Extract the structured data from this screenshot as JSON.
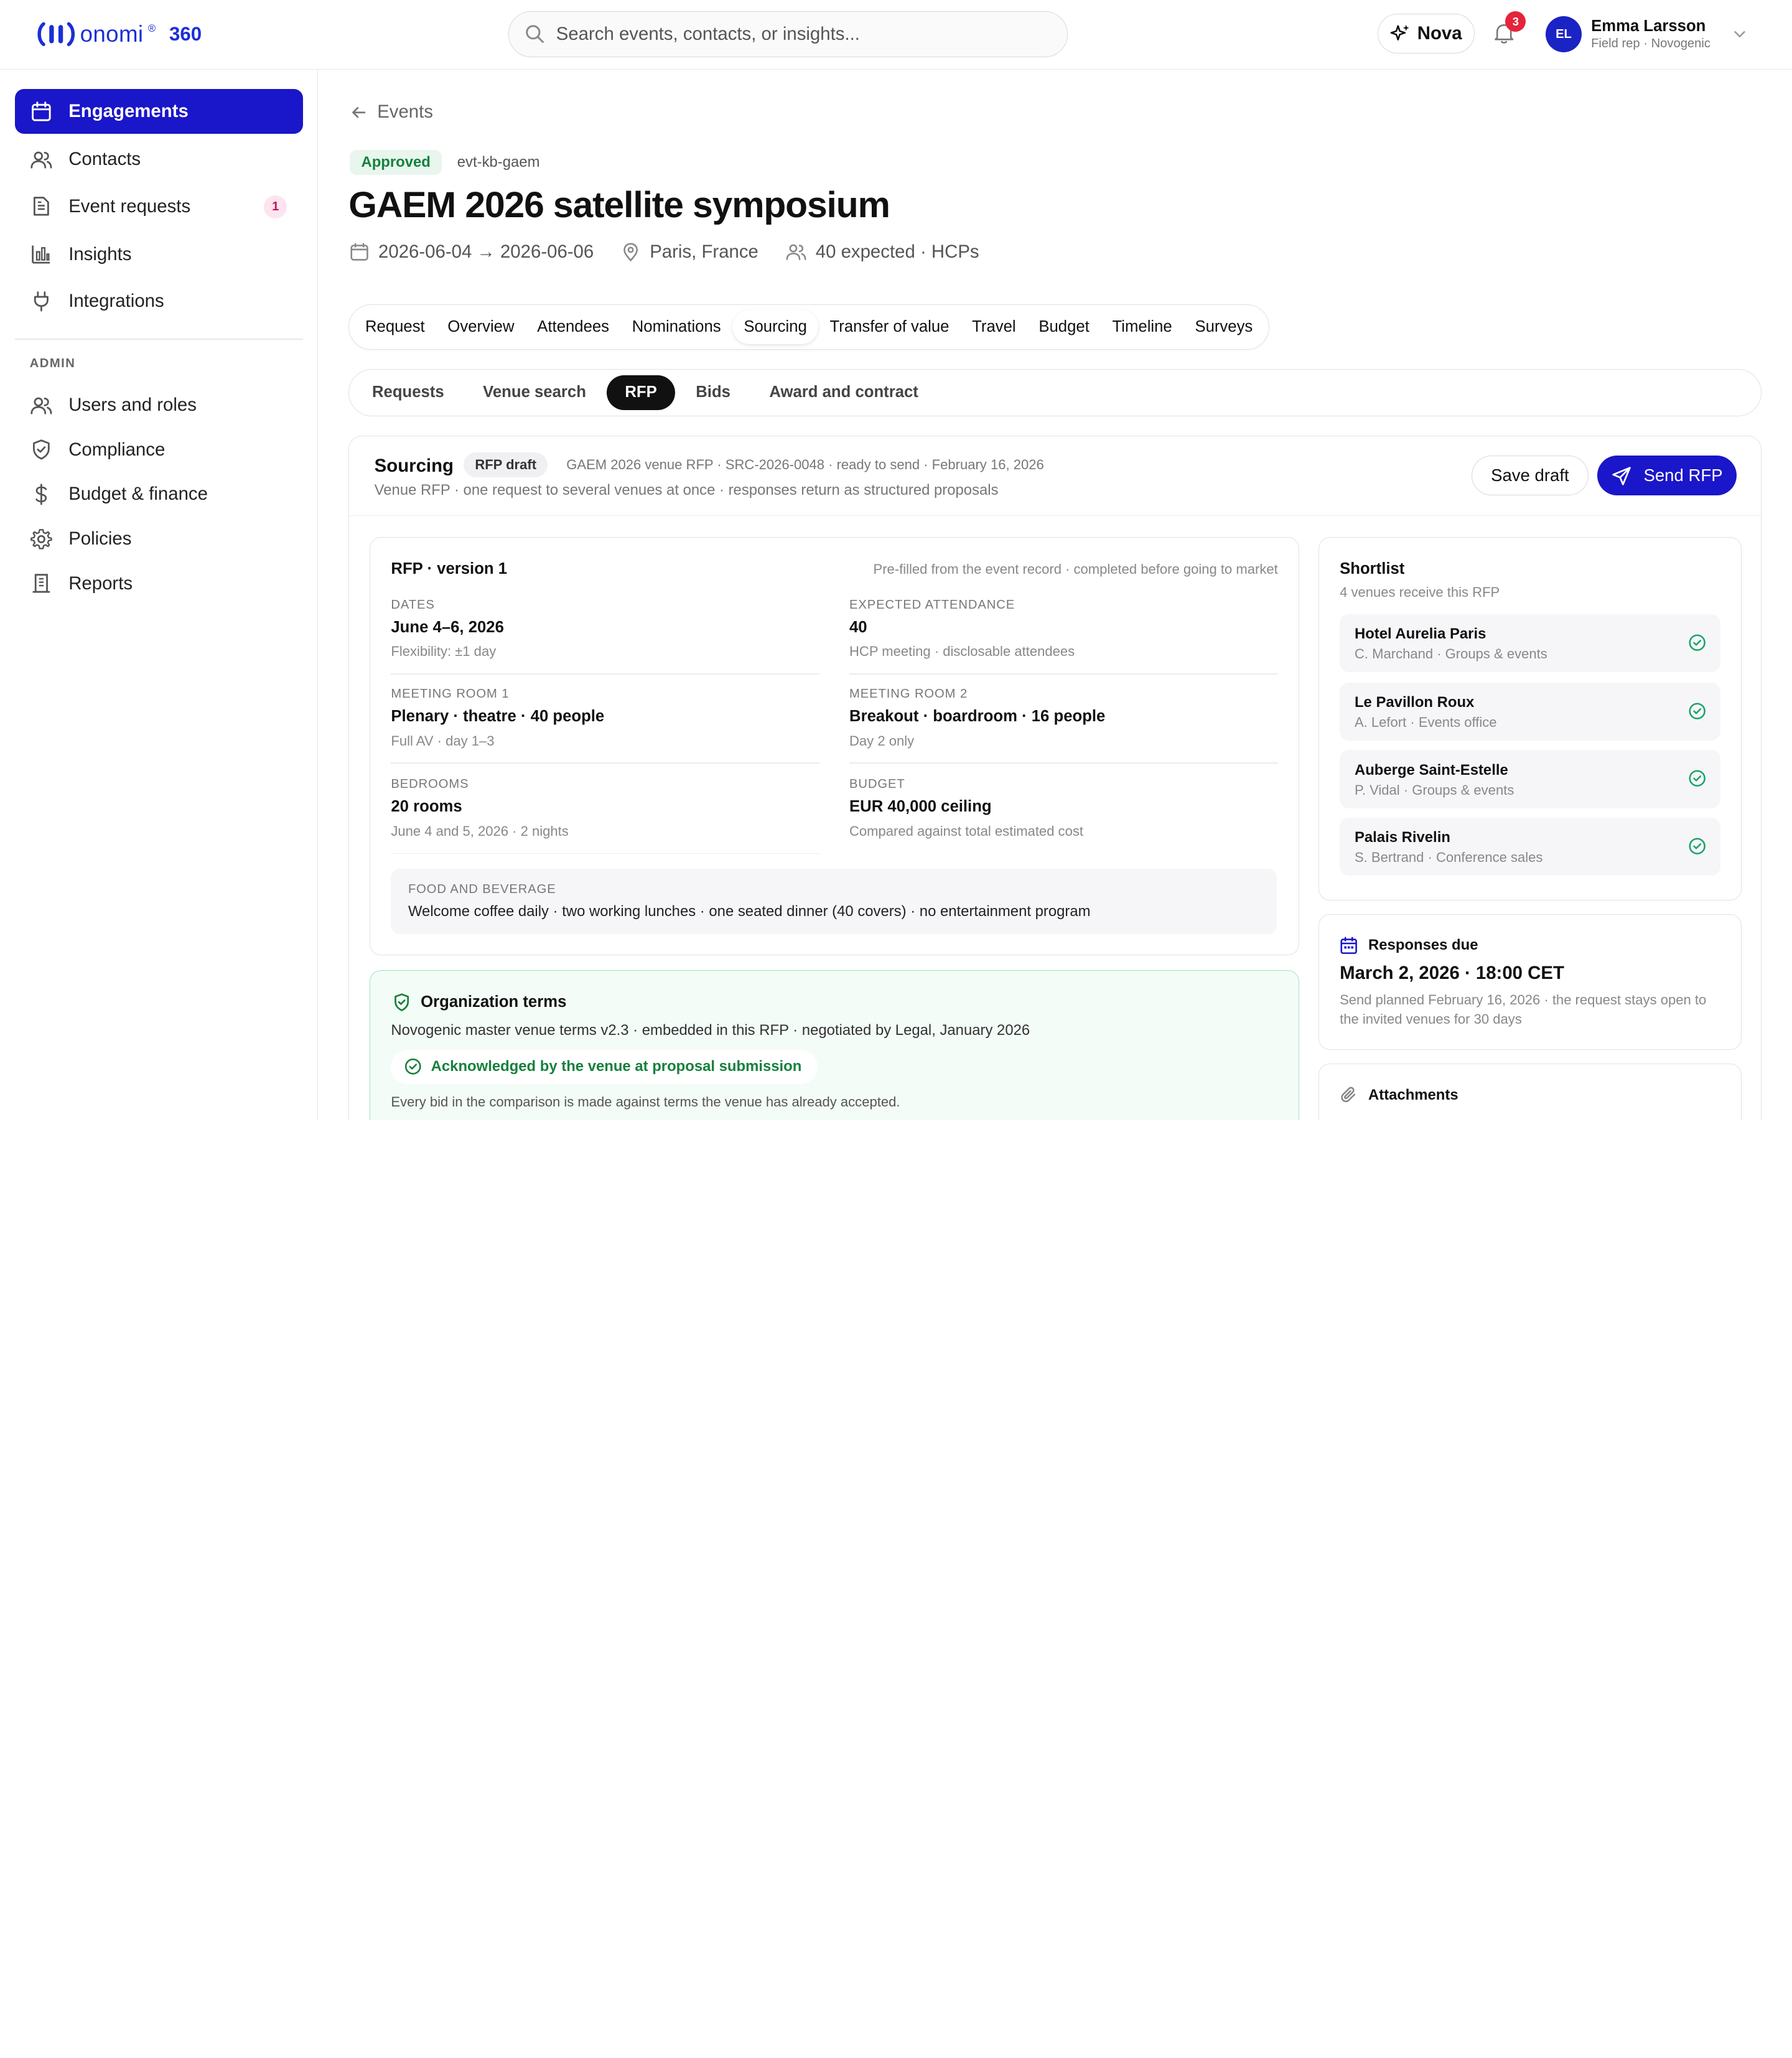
{
  "app": {
    "logo_text": "onomi",
    "logo_suffix": "360"
  },
  "search": {
    "placeholder": "Search events, contacts, or insights..."
  },
  "header": {
    "nova_label": "Nova",
    "notifications_count": "3",
    "user_initials": "EL",
    "user_name": "Emma Larsson",
    "user_role": "Field rep · Novogenic"
  },
  "sidebar": {
    "items": [
      {
        "label": "Engagements",
        "icon": "calendar-icon",
        "active": true
      },
      {
        "label": "Contacts",
        "icon": "users-icon"
      },
      {
        "label": "Event requests",
        "icon": "document-icon",
        "badge": "1"
      },
      {
        "label": "Insights",
        "icon": "bar-chart-icon"
      },
      {
        "label": "Integrations",
        "icon": "plug-icon"
      }
    ],
    "admin_heading": "ADMIN",
    "admin_items": [
      {
        "label": "Users and roles",
        "icon": "users-icon"
      },
      {
        "label": "Compliance",
        "icon": "shield-icon"
      },
      {
        "label": "Budget & finance",
        "icon": "dollar-icon"
      },
      {
        "label": "Policies",
        "icon": "gear-icon"
      },
      {
        "label": "Reports",
        "icon": "building-icon"
      }
    ]
  },
  "page": {
    "back_label": "Events",
    "status": "Approved",
    "event_code": "evt-kb-gaem",
    "title": "GAEM 2026 satellite symposium",
    "dates": "2026-06-04 → 2026-06-06",
    "location": "Paris, France",
    "attendance": "40 expected · HCPs"
  },
  "tabs": [
    "Request",
    "Overview",
    "Attendees",
    "Nominations",
    "Sourcing",
    "Transfer of value",
    "Travel",
    "Budget",
    "Timeline",
    "Surveys"
  ],
  "active_tab": "Sourcing",
  "subtabs": [
    "Requests",
    "Venue search",
    "RFP",
    "Bids",
    "Award and contract"
  ],
  "active_subtab": "RFP",
  "sourcing": {
    "title": "Sourcing",
    "chip": "RFP draft",
    "reference": "GAEM 2026 venue RFP · SRC-2026-0048 · ready to send · February 16, 2026",
    "subtitle": "Venue RFP · one request to several venues at once · responses return as structured proposals",
    "save_label": "Save draft",
    "send_label": "Send RFP"
  },
  "rfp": {
    "title": "RFP · version 1",
    "note": "Pre-filled from the event record · completed before going to market",
    "fields": [
      {
        "label": "DATES",
        "value": "June 4–6, 2026",
        "sub": "Flexibility: ±1 day"
      },
      {
        "label": "EXPECTED ATTENDANCE",
        "value": "40",
        "sub": "HCP meeting · disclosable attendees"
      },
      {
        "label": "MEETING ROOM 1",
        "value": "Plenary · theatre · 40 people",
        "sub": "Full AV · day 1–3"
      },
      {
        "label": "MEETING ROOM 2",
        "value": "Breakout · boardroom · 16 people",
        "sub": "Day 2 only"
      },
      {
        "label": "BEDROOMS",
        "value": "20 rooms",
        "sub": "June 4 and 5, 2026 · 2 nights"
      },
      {
        "label": "BUDGET",
        "value": "EUR 40,000 ceiling",
        "sub": "Compared against total estimated cost"
      }
    ],
    "fnb_label": "FOOD AND BEVERAGE",
    "fnb_value": "Welcome coffee daily · two working lunches · one seated dinner (40 covers) · no entertainment program"
  },
  "terms": {
    "title": "Organization terms",
    "text": "Novogenic master venue terms v2.3 · embedded in this RFP · negotiated by Legal, January 2026",
    "ack": "Acknowledged by the venue at proposal submission",
    "footer": "Every bid in the comparison is made against terms the venue has already accepted."
  },
  "shortlist": {
    "title": "Shortlist",
    "subtitle": "4 venues receive this RFP",
    "venues": [
      {
        "name": "Hotel Aurelia Paris",
        "contact": "C. Marchand · Groups & events"
      },
      {
        "name": "Le Pavillon Roux",
        "contact": "A. Lefort · Events office"
      },
      {
        "name": "Auberge Saint-Estelle",
        "contact": "P. Vidal · Groups & events"
      },
      {
        "name": "Palais Rivelin",
        "contact": "S. Bertrand · Conference sales"
      }
    ]
  },
  "responses": {
    "title": "Responses due",
    "value": "March 2, 2026 · 18:00 CET",
    "sub": "Send planned February 16, 2026 · the request stays open to the invited venues for 30 days"
  },
  "attachments": {
    "title": "Attachments"
  },
  "colors": {
    "brand": "#1a16c9",
    "approved": "#17803d",
    "badge_red": "#e5243b"
  }
}
